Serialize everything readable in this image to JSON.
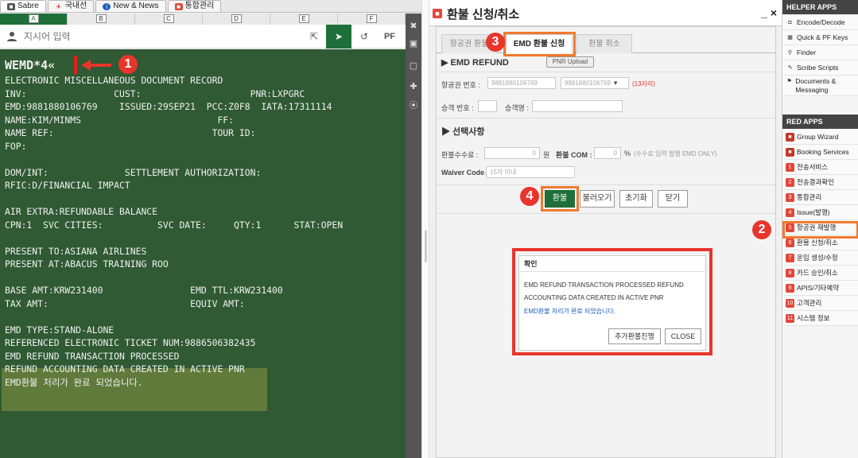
{
  "tabs": [
    {
      "label": "Sabre",
      "icon": "sabre-icon",
      "color": "#555555"
    },
    {
      "label": "국내선",
      "icon": "plane-icon",
      "color": "#e02020"
    },
    {
      "label": "New & News",
      "icon": "info-icon",
      "color": "#1a5ec0"
    },
    {
      "label": "통합관리",
      "icon": "app-icon",
      "color": "#e0483a"
    }
  ],
  "columns": [
    "A",
    "B",
    "C",
    "D",
    "E",
    "F"
  ],
  "command": {
    "placeholder": "지시어 입력",
    "pf_label": "PF"
  },
  "terminal": {
    "lines": [
      "WEMD*4«",
      "ELECTRONIC MISCELLANEOUS DOCUMENT RECORD",
      "INV:                CUST:                    PNR:LXPGRC",
      "EMD:9881880106769    ISSUED:29SEP21  PCC:Z0F8  IATA:17311114",
      "NAME:KIM/MINMS                         FF:",
      "NAME REF:                             TOUR ID:",
      "FOP:",
      "",
      "DOM/INT:              SETTLEMENT AUTHORIZATION:",
      "RFIC:D/FINANCIAL IMPACT",
      "",
      "AIR EXTRA:REFUNDABLE BALANCE",
      "CPN:1  SVC CITIES:          SVC DATE:     QTY:1      STAT:OPEN",
      "",
      "PRESENT TO:ASIANA AIRLINES",
      "PRESENT AT:ABACUS TRAINING ROO",
      "",
      "BASE AMT:KRW231400                EMD TTL:KRW231400",
      "TAX AMT:                          EQUIV AMT:",
      "",
      "EMD TYPE:STAND-ALONE",
      "REFERENCED ELECTRONIC TICKET NUM:9886506382435",
      "EMD REFUND TRANSACTION PROCESSED",
      "REFUND ACCOUNTING DATA CREATED IN ACTIVE PNR",
      "EMD환불 처리가 완료 되었습니다."
    ],
    "bg": "#2f5a33"
  },
  "badges": [
    "1",
    "2",
    "3",
    "4"
  ],
  "refund": {
    "title": "환불 신청/취소",
    "window_controls": "_ ×",
    "tabs": [
      "항공권 환불",
      "EMD 환불 신청",
      "환불 취소"
    ],
    "section1": "▶ EMD REFUND",
    "pnr_upload": "PNR Upload",
    "ticket_label": "항공권 번호 :",
    "ticket_value1": "9881880106769",
    "ticket_value2": "9881880106769",
    "ticket_dropdown": "▼",
    "ticket_hint": "(13자리)",
    "passenger_no_label": "승객 번호 :",
    "passenger_name_label": "승객명 :",
    "section2": "▶ 선택사항",
    "fee_label": "환불수수료 :",
    "fee_value": "0",
    "fee_unit": "원",
    "com_label": "환불 COM :",
    "com_value": "0",
    "com_unit": "%",
    "com_hint": "(수수료 입력 발행 EMD ONLY)",
    "waiver_label": "Waiver Code :",
    "waiver_placeholder": "15자 이내",
    "buttons": [
      "환불",
      "불러오기",
      "초기화",
      "닫기"
    ]
  },
  "dialog": {
    "title": "확인",
    "line1": "EMD REFUND TRANSACTION PROCESSED REFUND",
    "line2": "ACCOUNTING DATA CREATED IN ACTIVE PNR",
    "line3": "EMD환불 처리가 완료 되었습니다.",
    "more_button": "추가환불진행",
    "close_button": "CLOSE"
  },
  "helper": {
    "header": "HELPER APPS",
    "items": [
      {
        "label": "Encode/Decode",
        "icon": "encode-icon"
      },
      {
        "label": "Quick & PF Keys",
        "icon": "keyboard-icon"
      },
      {
        "label": "Finder",
        "icon": "search-icon"
      },
      {
        "label": "Scribe Scripts",
        "icon": "script-icon"
      },
      {
        "label": "Documents & Messaging",
        "icon": "pin-icon"
      }
    ]
  },
  "red_apps": {
    "header": "RED APPS",
    "items": [
      {
        "label": "Group Wizard",
        "icon": "group-icon",
        "num": "",
        "color": "#c0392b"
      },
      {
        "label": "Booking Services",
        "icon": "booking-icon",
        "num": "",
        "color": "#c0392b"
      },
      {
        "label": "전송서비스",
        "icon": "num-icon",
        "num": "1",
        "color": "#e0483a"
      },
      {
        "label": "전송결과확인",
        "icon": "num-icon",
        "num": "2",
        "color": "#e0483a"
      },
      {
        "label": "통합관리",
        "icon": "num-icon",
        "num": "3",
        "color": "#e0483a"
      },
      {
        "label": "Issue(발행)",
        "icon": "num-icon",
        "num": "4",
        "color": "#e0483a"
      },
      {
        "label": "항공권 재발행",
        "icon": "num-icon",
        "num": "5",
        "color": "#e0483a"
      },
      {
        "label": "환불 신청/취소",
        "icon": "num-icon",
        "num": "6",
        "color": "#e0483a"
      },
      {
        "label": "운임 생성/수정",
        "icon": "num-icon",
        "num": "7",
        "color": "#e0483a"
      },
      {
        "label": "카드 승인/취소",
        "icon": "num-icon",
        "num": "8",
        "color": "#e0483a"
      },
      {
        "label": "APIS/기타예약",
        "icon": "num-icon",
        "num": "9",
        "color": "#e0483a"
      },
      {
        "label": "고객관리",
        "icon": "num-icon",
        "num": "10",
        "color": "#e0483a"
      },
      {
        "label": "시스템 정보",
        "icon": "num-icon",
        "num": "11",
        "color": "#e0483a"
      }
    ]
  },
  "colors": {
    "accent": "#1f6f3a",
    "highlight": "#f07a2e",
    "badge": "#e8352c"
  }
}
